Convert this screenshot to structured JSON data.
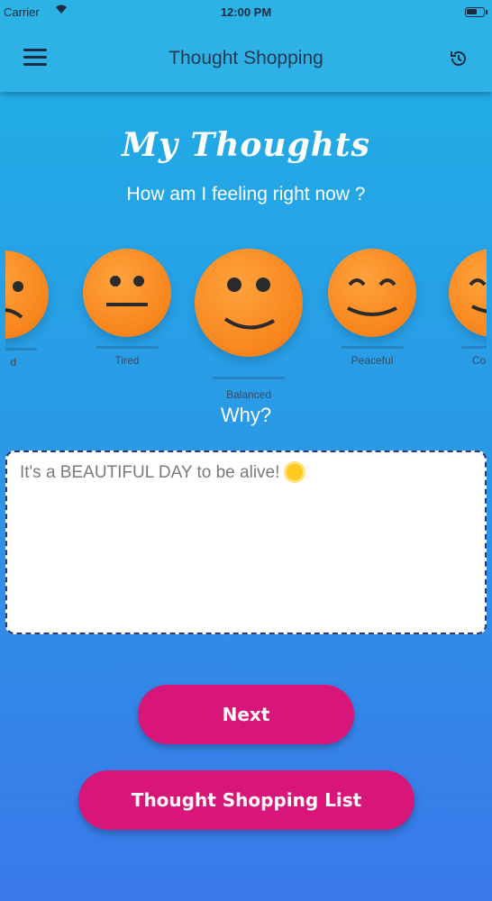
{
  "status_bar": {
    "carrier": "Carrier",
    "time": "12:00 PM"
  },
  "nav": {
    "title": "Thought Shopping"
  },
  "page": {
    "title": "My Thoughts",
    "subtitle": "How am I feeling right now ?",
    "why": "Why?",
    "thought_text": "It's a BEAUTIFUL DAY to be alive!"
  },
  "moods": [
    {
      "label": "d",
      "expression": "sad"
    },
    {
      "label": "Tired",
      "expression": "tired"
    },
    {
      "label": "Balanced",
      "expression": "balanced",
      "selected": true
    },
    {
      "label": "Peaceful",
      "expression": "peaceful"
    },
    {
      "label": "Co",
      "expression": "content"
    }
  ],
  "buttons": {
    "next": "Next",
    "list": "Thought Shopping List"
  },
  "colors": {
    "accent": "#d8167a",
    "face": "#f7851c",
    "nav": "#2eb2e6"
  },
  "icons": {
    "menu": "hamburger-icon",
    "history": "history-icon",
    "sun": "sun-emoji"
  }
}
